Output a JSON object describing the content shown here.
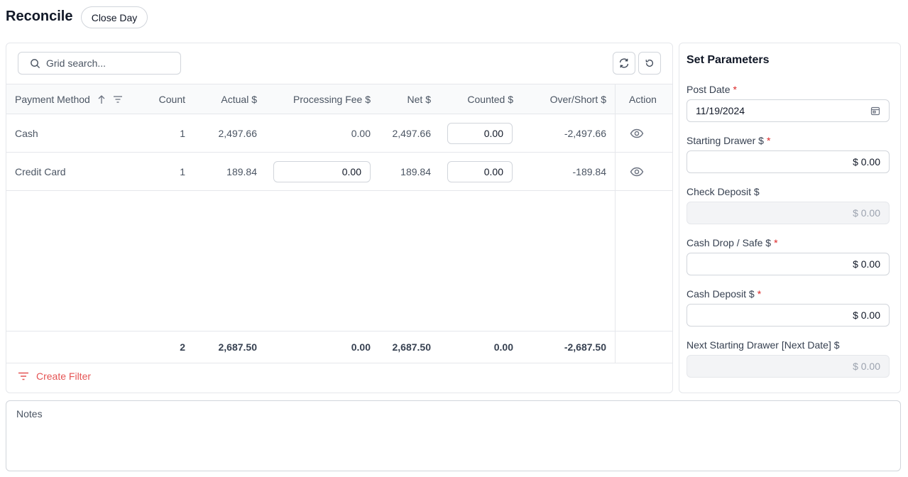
{
  "page": {
    "title": "Reconcile",
    "close_day_label": "Close Day"
  },
  "grid": {
    "search_placeholder": "Grid search...",
    "columns": [
      "Payment Method",
      "Count",
      "Actual $",
      "Processing Fee $",
      "Net $",
      "Counted $",
      "Over/Short $",
      "Action"
    ],
    "rows": [
      {
        "method": "Cash",
        "count": "1",
        "actual": "2,497.66",
        "fee": "0.00",
        "net": "2,497.66",
        "counted": "0.00",
        "over_short": "-2,497.66"
      },
      {
        "method": "Credit Card",
        "count": "1",
        "actual": "189.84",
        "fee": "0.00",
        "net": "189.84",
        "counted": "0.00",
        "over_short": "-189.84"
      }
    ],
    "totals": {
      "count": "2",
      "actual": "2,687.50",
      "fee": "0.00",
      "net": "2,687.50",
      "counted": "0.00",
      "over_short": "-2,687.50"
    },
    "create_filter_label": "Create Filter",
    "icons": {
      "search": "search-icon",
      "refresh": "refresh-icon",
      "reset": "reset-icon",
      "sort": "sort-asc-icon",
      "filter": "filter-icon",
      "view": "eye-icon"
    }
  },
  "params": {
    "title": "Set Parameters",
    "post_date": {
      "label": "Post Date",
      "required": "*",
      "value": "11/19/2024"
    },
    "starting_drawer": {
      "label": "Starting Drawer $",
      "required": "*",
      "value": "$ 0.00"
    },
    "check_deposit": {
      "label": "Check Deposit $",
      "value": "$ 0.00"
    },
    "cash_drop": {
      "label": "Cash Drop / Safe $",
      "required": "*",
      "value": "$ 0.00"
    },
    "cash_deposit": {
      "label": "Cash Deposit $",
      "required": "*",
      "value": "$ 0.00"
    },
    "next_starting": {
      "label": "Next Starting Drawer [Next Date] $",
      "value": "$ 0.00"
    }
  },
  "notes": {
    "placeholder": "Notes"
  },
  "colors": {
    "accent_red": "#e55454",
    "required": "#dc2626",
    "border": "#e5e7eb"
  }
}
